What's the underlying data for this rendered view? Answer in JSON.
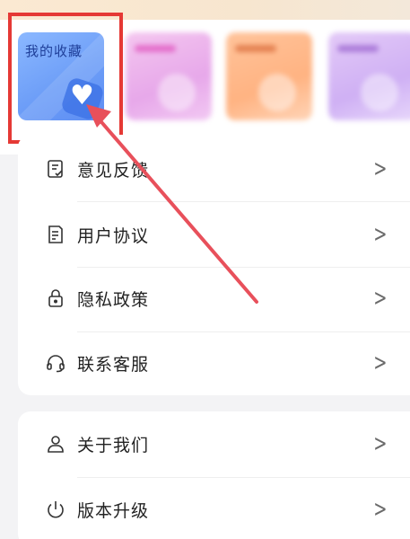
{
  "favorites_tile": {
    "label": "我的收藏"
  },
  "menu": {
    "group1": [
      {
        "label": "意见反馈",
        "icon": "feedback-icon"
      },
      {
        "label": "用户协议",
        "icon": "document-icon"
      },
      {
        "label": "隐私政策",
        "icon": "lock-icon"
      },
      {
        "label": "联系客服",
        "icon": "headset-icon"
      }
    ],
    "group2": [
      {
        "label": "关于我们",
        "icon": "person-icon"
      },
      {
        "label": "版本升级",
        "icon": "power-icon"
      }
    ]
  },
  "colors": {
    "highlight": "#e53935",
    "favorites_tile": "#6b9cf7",
    "arrow": "#e8505b"
  }
}
